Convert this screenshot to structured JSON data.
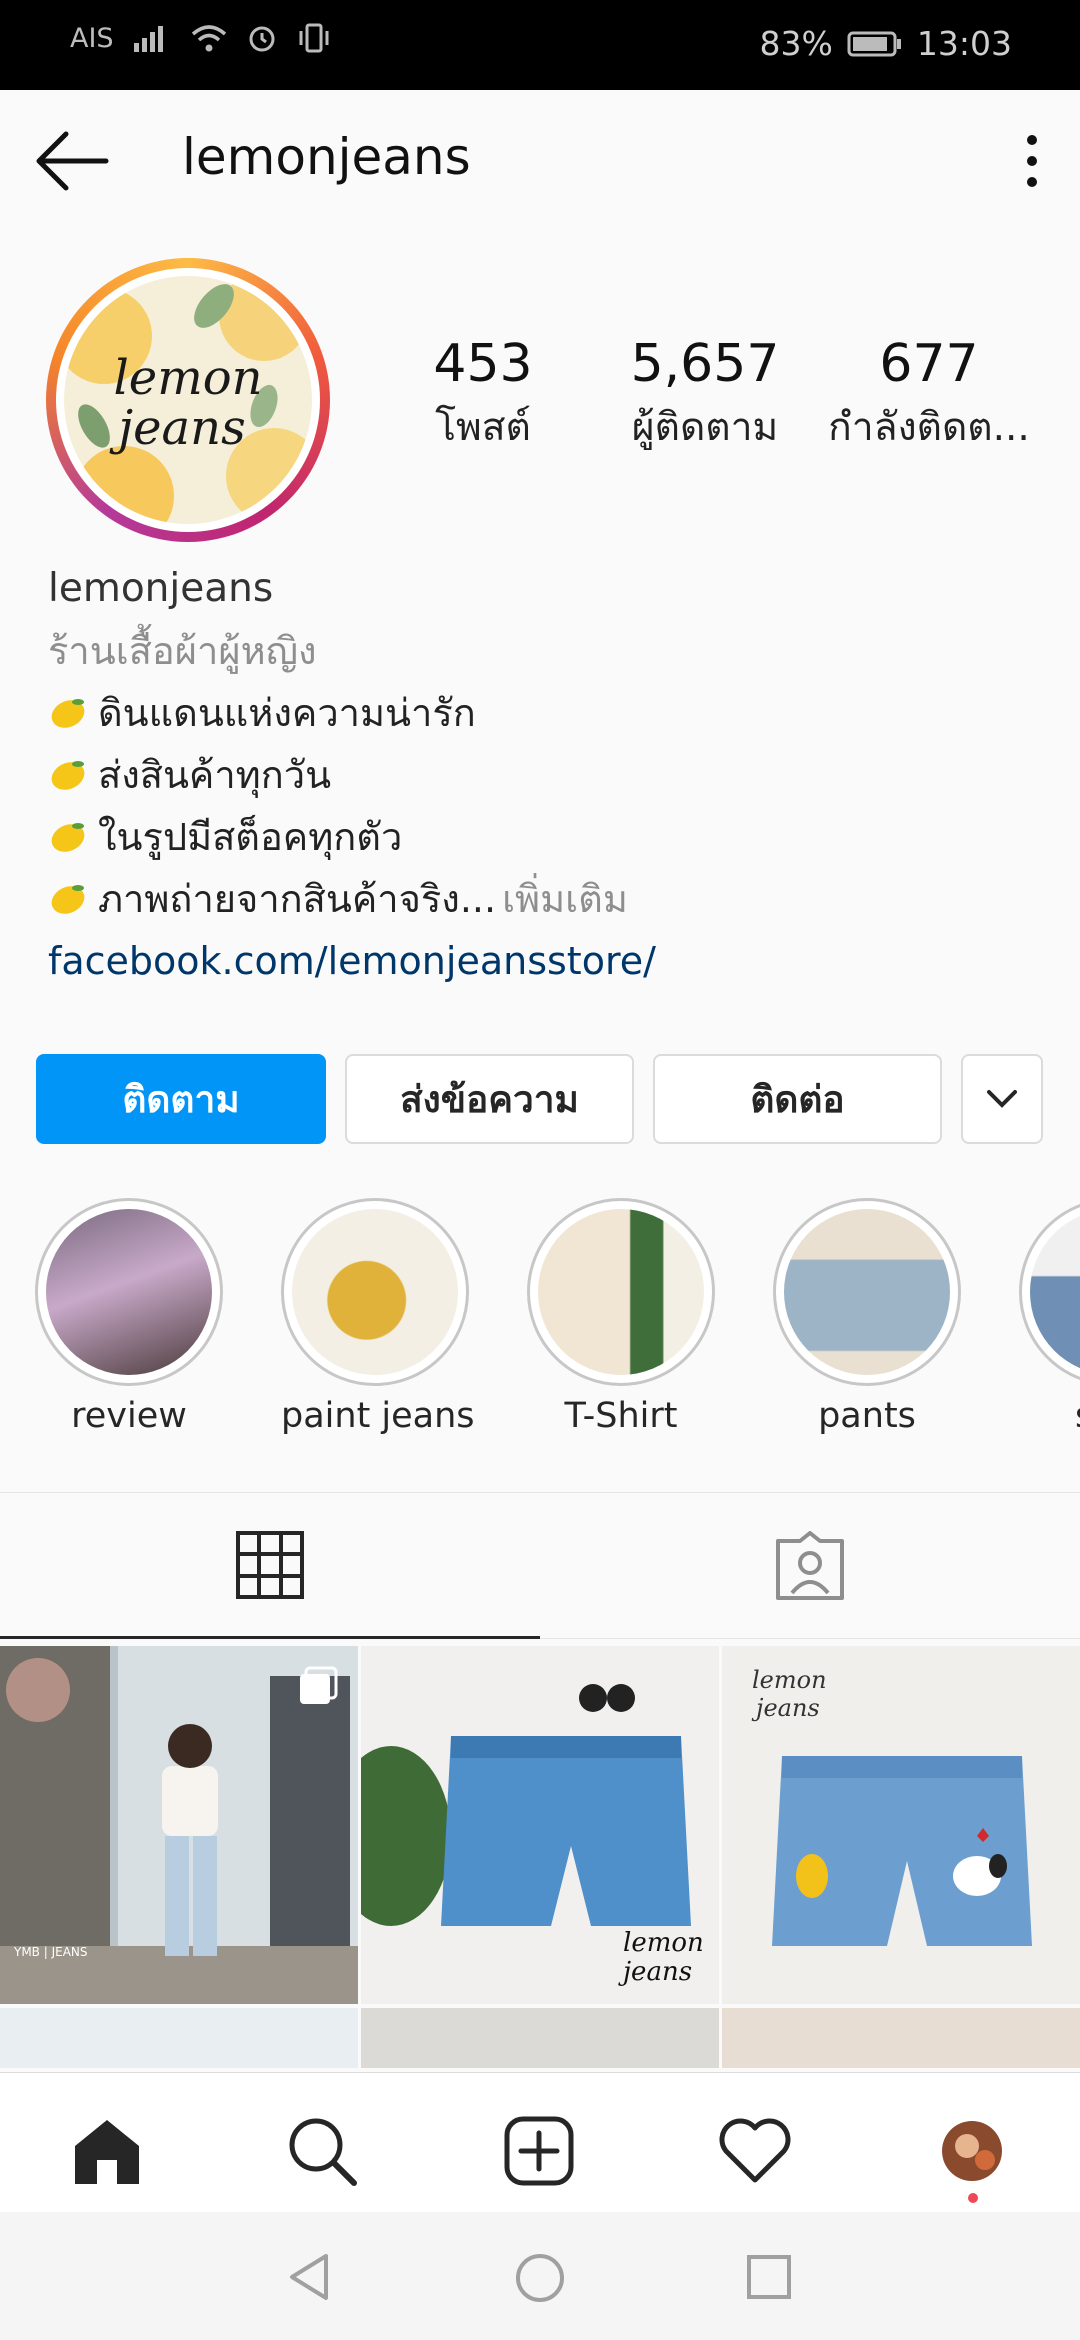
{
  "status_bar": {
    "carrier": "AIS",
    "battery": "83%",
    "time": "13:03"
  },
  "header": {
    "username": "lemonjeans"
  },
  "profile": {
    "avatar_text": [
      "lemon",
      "jeans"
    ],
    "stats": [
      {
        "value": "453",
        "label": "โพสต์"
      },
      {
        "value": "5,657",
        "label": "ผู้ติดตาม"
      },
      {
        "value": "677",
        "label": "กำลังติดต..."
      }
    ],
    "name": "lemonjeans",
    "category": "ร้านเสื้อผ้าผู้หญิง",
    "bio_lines": [
      "ดินแดนแห่งความน่ารัก",
      "ส่งสินค้าทุกวัน",
      "ในรูปมีสต็อคทุกตัว",
      "ภาพถ่ายจากสินค้าจริง..."
    ],
    "more_label": " เพิ่มเติม",
    "url": "facebook.com/lemonjeansstore/"
  },
  "actions": {
    "follow": "ติดตาม",
    "message": "ส่งข้อความ",
    "contact": "ติดต่อ"
  },
  "highlights": [
    {
      "label": "review"
    },
    {
      "label": "paint jeans"
    },
    {
      "label": "T-Shirt"
    },
    {
      "label": "pants"
    },
    {
      "label": "s"
    }
  ],
  "posts": {
    "post1_text": "YMB | JEANS",
    "post2_text": [
      "lemon",
      "jeans"
    ],
    "post3_text": [
      "lemon",
      "jeans"
    ]
  },
  "colors": {
    "primary": "#0095f6",
    "link": "#00376b",
    "muted": "#8e8e8e",
    "notification": "#ed4956"
  },
  "icons": [
    "back-arrow-icon",
    "more-vertical-icon",
    "grid-icon",
    "tagged-icon",
    "home-icon",
    "search-icon",
    "add-post-icon",
    "heart-icon",
    "chevron-down-icon"
  ]
}
